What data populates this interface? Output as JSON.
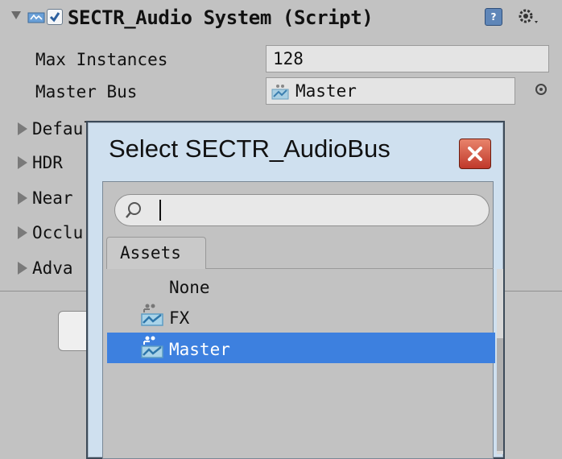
{
  "inspector": {
    "component_title": "SECTR_Audio System (Script)",
    "help_symbol": "?",
    "properties": [
      {
        "label": "Max Instances",
        "value": "128"
      },
      {
        "label": "Master Bus",
        "value": "Master"
      }
    ],
    "foldouts": [
      "Default Audio",
      "HDR",
      "Near",
      "Occlu",
      "Adva"
    ]
  },
  "dialog": {
    "title": "Select SECTR_AudioBus",
    "search": {
      "value": "",
      "placeholder": ""
    },
    "tab": "Assets",
    "items": [
      "None",
      "FX",
      "Master"
    ],
    "selected": "Master"
  },
  "colors": {
    "selection": "#3d80df",
    "close_button": "#c0392b",
    "dialog_frame": "#cfe0ef"
  },
  "icons": [
    "foldout-arrow-icon",
    "script-icon",
    "checkbox-checked-icon",
    "help-icon",
    "gear-icon",
    "object-picker-icon",
    "close-icon",
    "search-icon",
    "audio-bus-icon"
  ]
}
